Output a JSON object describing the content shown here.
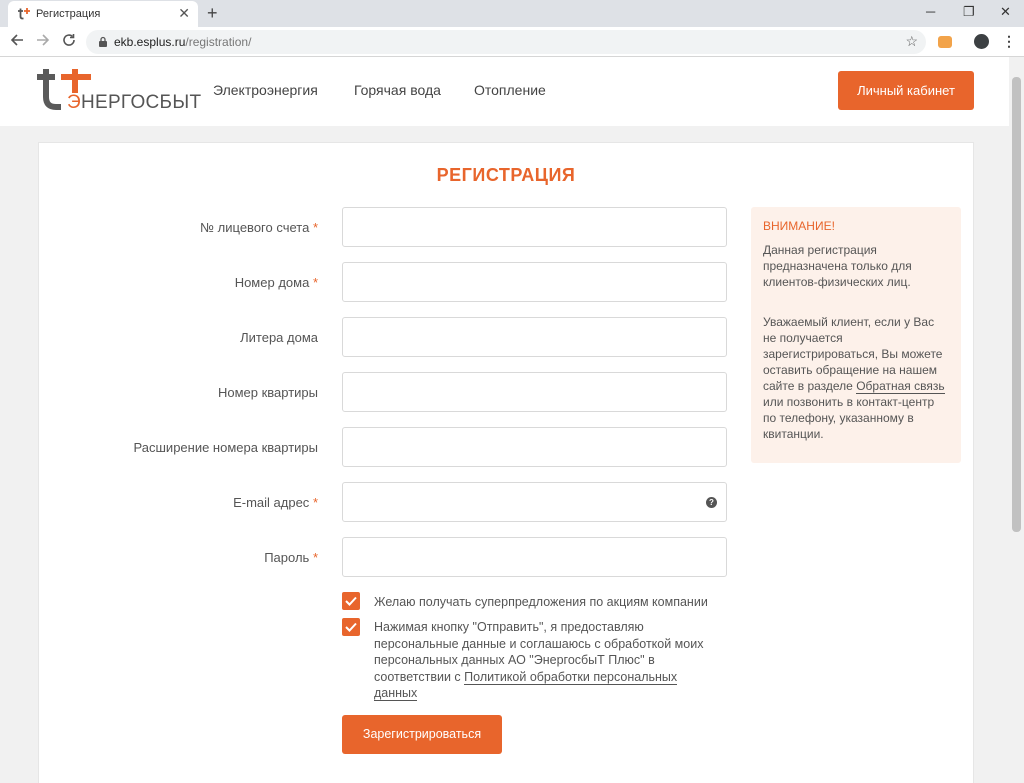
{
  "browser": {
    "tab_title": "Регистрация",
    "tab_close": "✕",
    "new_tab": "+",
    "url_host": "ekb.esplus.ru",
    "url_path": "/registration/",
    "minimize": "─",
    "maximize": "❐",
    "close": "✕"
  },
  "header": {
    "logo_text_accent": "Э",
    "logo_text_main": "НЕРГОСБЫТ",
    "nav": [
      "Электроэнергия",
      "Горячая вода",
      "Отопление"
    ],
    "cabinet_button": "Личный кабинет"
  },
  "form": {
    "title": "РЕГИСТРАЦИЯ",
    "required_mark": "*",
    "fields": [
      {
        "label": "№ лицевого счета",
        "required": true,
        "value": ""
      },
      {
        "label": "Номер дома",
        "required": true,
        "value": ""
      },
      {
        "label": "Литера дома",
        "required": false,
        "value": ""
      },
      {
        "label": "Номер квартиры",
        "required": false,
        "value": ""
      },
      {
        "label": "Расширение номера квартиры",
        "required": false,
        "value": ""
      },
      {
        "label": "E-mail адрес",
        "required": true,
        "value": ""
      },
      {
        "label": "Пароль",
        "required": true,
        "value": ""
      }
    ],
    "email_help": "?",
    "checkbox_promo": {
      "checked": true,
      "label": "Желаю получать суперпредложения по акциям компании"
    },
    "checkbox_consent": {
      "checked": true,
      "label_line1": "Нажимая кнопку \"Отправить\", я предоставляю",
      "label_line2": "персональные данные и соглашаюсь с обработкой моих",
      "label_line3": "персональных данных АО \"ЭнергосбыТ Плюс\" в",
      "label_line4_prefix": "соответствии с ",
      "policy_link_line1": "Политикой обработки персональных",
      "policy_link_line2": "данных"
    },
    "submit_button": "Зарегистрироваться"
  },
  "notice": {
    "title": "ВНИМАНИЕ!",
    "paragraph1": "Данная регистрация предназначена только для клиентов-физических лиц.",
    "paragraph2_before": "Уважаемый клиент, если у Вас не получается зарегистрироваться, Вы можете оставить обращение на нашем сайте в разделе ",
    "feedback_link": "Обратная связь",
    "paragraph2_after": " или позвонить в контакт-центр по телефону, указанному в квитанции."
  },
  "colors": {
    "accent": "#e8652c",
    "notice_bg": "#fdf1ea"
  }
}
